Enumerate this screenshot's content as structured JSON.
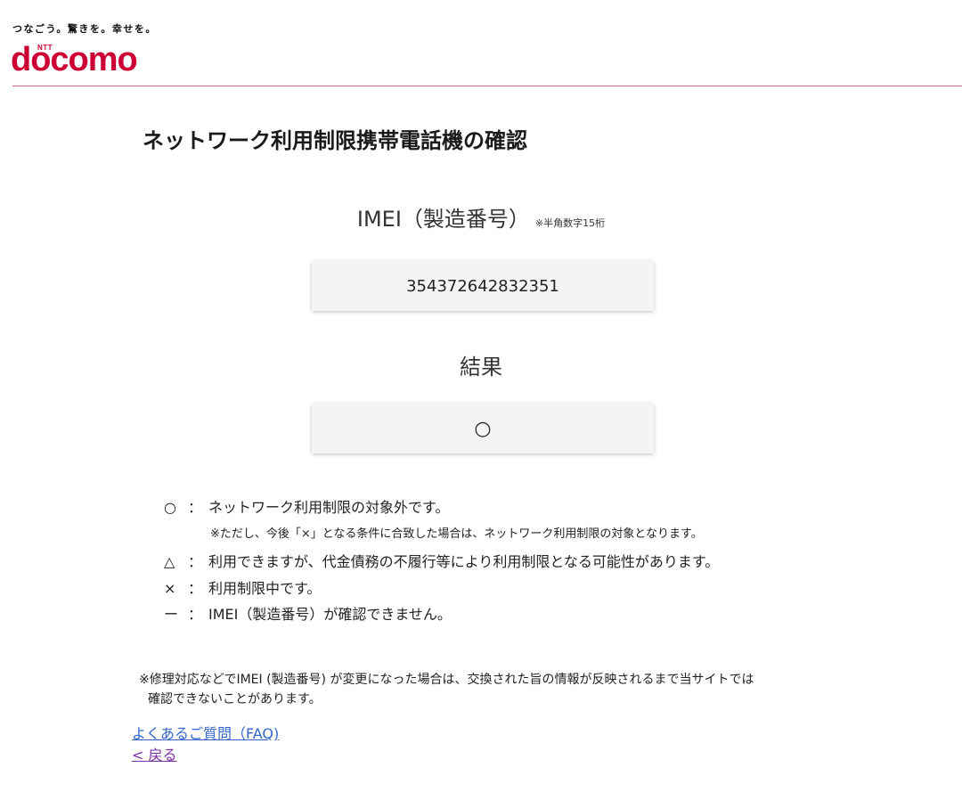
{
  "header": {
    "tagline": "つなごう。驚きを。幸せを。",
    "logo_small": "NTT",
    "logo_word": "docomo"
  },
  "page_title": "ネットワーク利用制限携帯電話機の確認",
  "imei": {
    "label": "IMEI（製造番号）",
    "note": "※半角数字15桁",
    "value": "354372642832351"
  },
  "result": {
    "label": "結果",
    "value": "○"
  },
  "legend": [
    {
      "symbol": "○",
      "colon": "：",
      "text": "ネットワーク利用制限の対象外です。"
    },
    {
      "symbol": "△",
      "colon": "：",
      "text": "利用できますが、代金債務の不履行等により利用制限となる可能性があります。"
    },
    {
      "symbol": "×",
      "colon": "：",
      "text": "利用制限中です。"
    },
    {
      "symbol": "ー",
      "colon": "：",
      "text": "IMEI（製造番号）が確認できません。"
    }
  ],
  "legend_note": "※ただし、今後「×」となる条件に合致した場合は、ネットワーク利用制限の対象となります。",
  "footnote": {
    "line1": "※修理対応などでIMEI (製造番号) が変更になった場合は、交換された旨の情報が反映されるまで当サイトでは",
    "line2": "確認できないことがあります。"
  },
  "links": {
    "faq": "よくあるご質問（FAQ)",
    "back": "< 戻る"
  },
  "colors": {
    "brand": "#cc0033",
    "link": "#3366cc",
    "visited_link": "#7a2fa8"
  }
}
